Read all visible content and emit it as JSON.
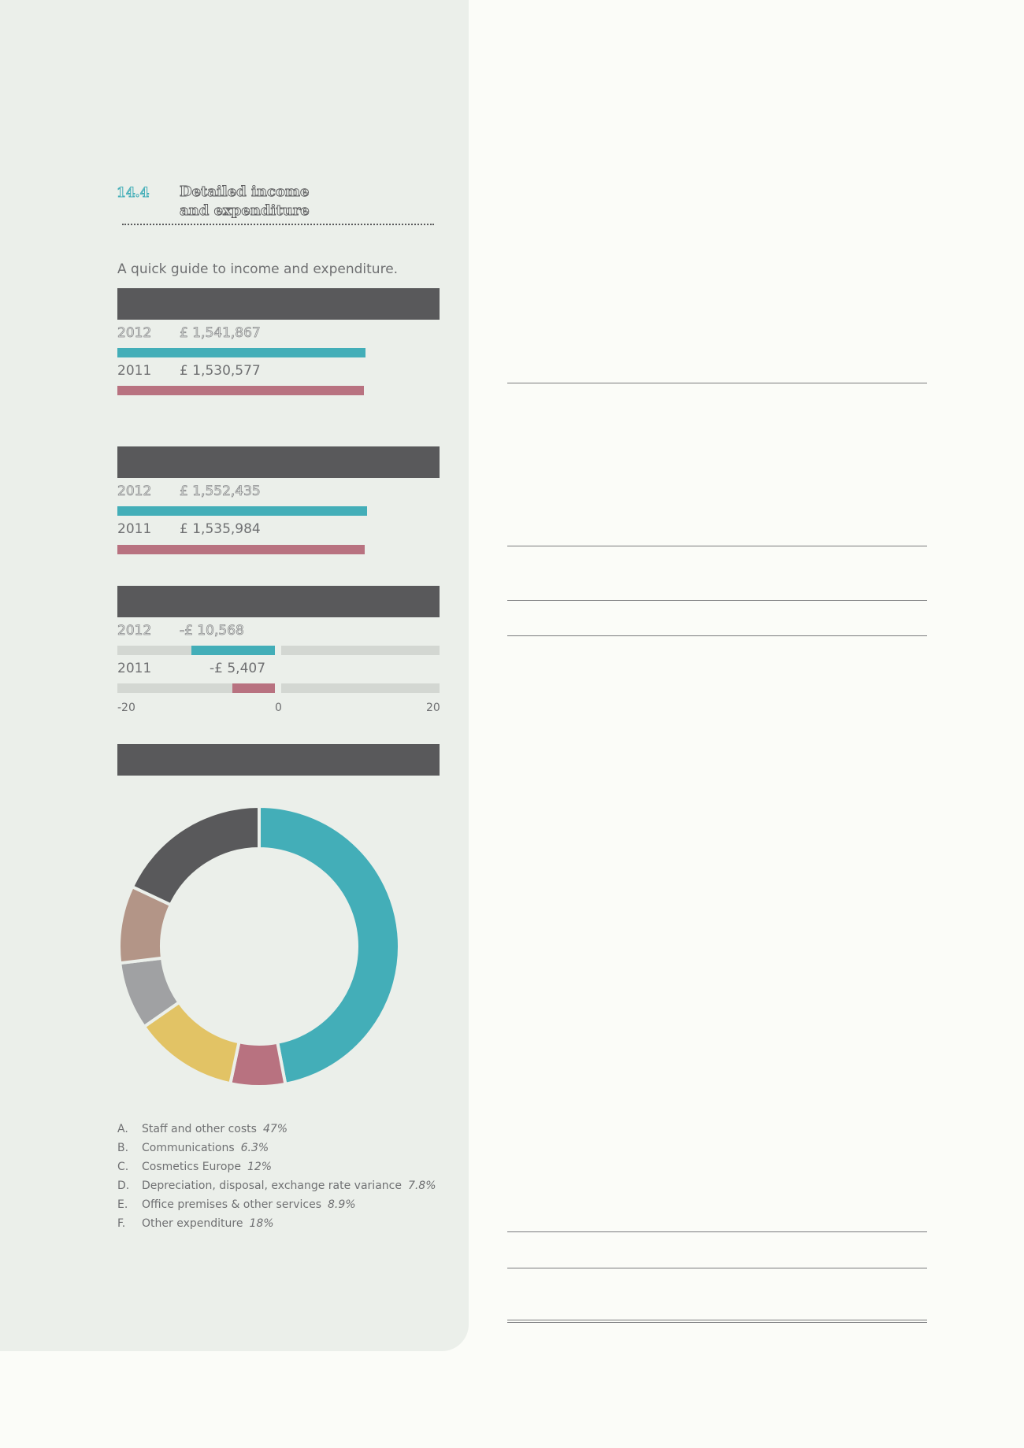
{
  "section": {
    "number": "14.4",
    "title_line1": "Detailed income",
    "title_line2": "and expenditure"
  },
  "intro": "A quick guide to income and expenditure.",
  "chart_data": [
    {
      "type": "bar",
      "orientation": "horizontal",
      "title": "",
      "categories": [
        "2012",
        "2011"
      ],
      "values": [
        1541867,
        1530577
      ],
      "labels": [
        "£ 1,541,867",
        "£ 1,530,577"
      ],
      "colors": [
        "#43aeb8",
        "#b87280"
      ]
    },
    {
      "type": "bar",
      "orientation": "horizontal",
      "title": "",
      "categories": [
        "2012",
        "2011"
      ],
      "values": [
        1552435,
        1535984
      ],
      "labels": [
        "£ 1,552,435",
        "£ 1,535,984"
      ],
      "colors": [
        "#43aeb8",
        "#b87280"
      ]
    },
    {
      "type": "bar",
      "orientation": "horizontal",
      "title": "",
      "categories": [
        "2012",
        "2011"
      ],
      "values": [
        -10.568,
        -5.407
      ],
      "labels": [
        "-£ 10,568",
        "-£ 5,407"
      ],
      "colors": [
        "#43aeb8",
        "#b87280"
      ],
      "xlim": [
        -20,
        20
      ],
      "xticks": [
        "-20",
        "0",
        "20"
      ]
    },
    {
      "type": "pie",
      "title": "",
      "donut": true,
      "slices": [
        {
          "letter": "A.",
          "label": "Staff and other costs",
          "pct_label": "47%",
          "value": 47,
          "color": "#43aeb8"
        },
        {
          "letter": "B.",
          "label": "Communications",
          "pct_label": "6.3%",
          "value": 6.3,
          "color": "#b87280"
        },
        {
          "letter": "C.",
          "label": "Cosmetics Europe",
          "pct_label": "12%",
          "value": 12,
          "color": "#e2c365"
        },
        {
          "letter": "D.",
          "label": "Depreciation, disposal, exchange rate variance",
          "pct_label": "7.8%",
          "value": 7.8,
          "color": "#a0a1a3"
        },
        {
          "letter": "E.",
          "label": "Office premises & other services",
          "pct_label": "8.9%",
          "value": 8.9,
          "color": "#b39587"
        },
        {
          "letter": "F.",
          "label": "Other expenditure",
          "pct_label": "18%",
          "value": 18,
          "color": "#59595b"
        }
      ]
    }
  ]
}
